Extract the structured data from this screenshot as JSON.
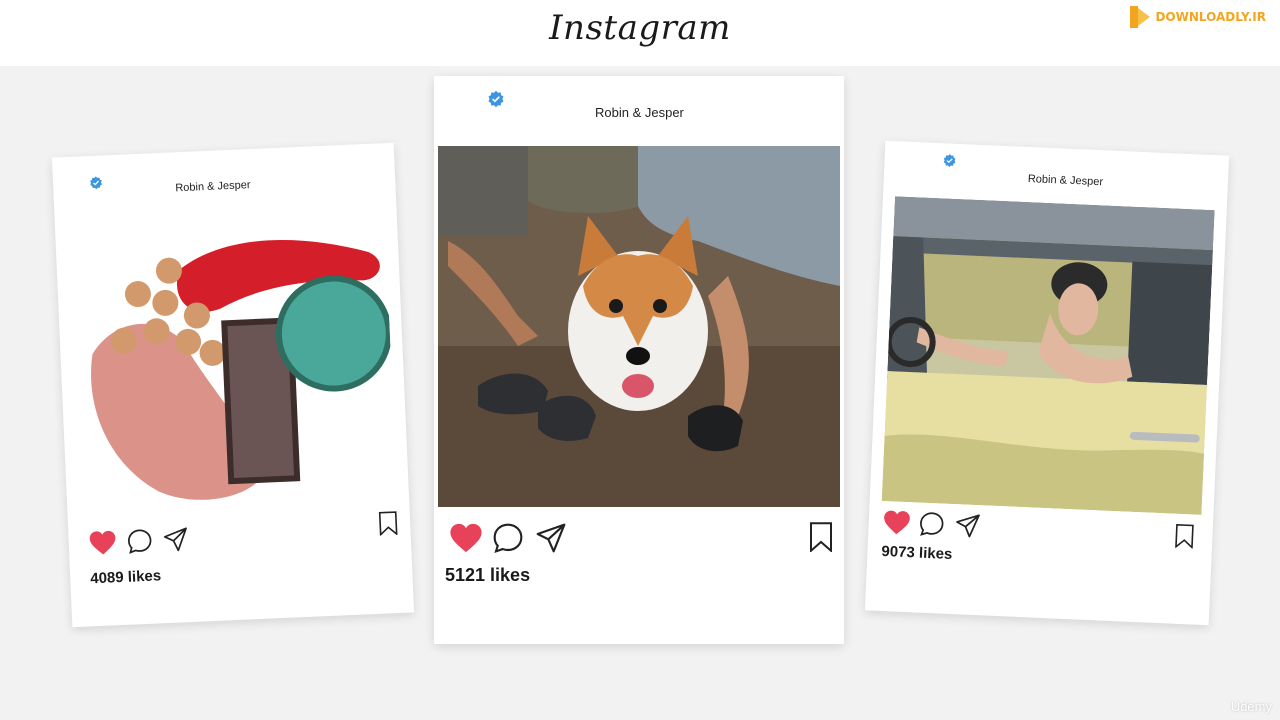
{
  "header": {
    "logo": "Instagram",
    "badge": "DOWNLOADLY.IR"
  },
  "watermark": "Udemy",
  "posts": [
    {
      "author": "Robin & Jesper",
      "likes": "4089 likes",
      "image_subject": "cosmetics-flatlay",
      "liked": true
    },
    {
      "author": "Robin & Jesper",
      "likes": "5121 likes",
      "image_subject": "corgi-with-people",
      "liked": true
    },
    {
      "author": "Robin & Jesper",
      "likes": "9073 likes",
      "image_subject": "woman-driving-car",
      "liked": true
    }
  ],
  "colors": {
    "heart": "#e8415a",
    "verified": "#3d95e0",
    "background": "#f2f2f2"
  }
}
